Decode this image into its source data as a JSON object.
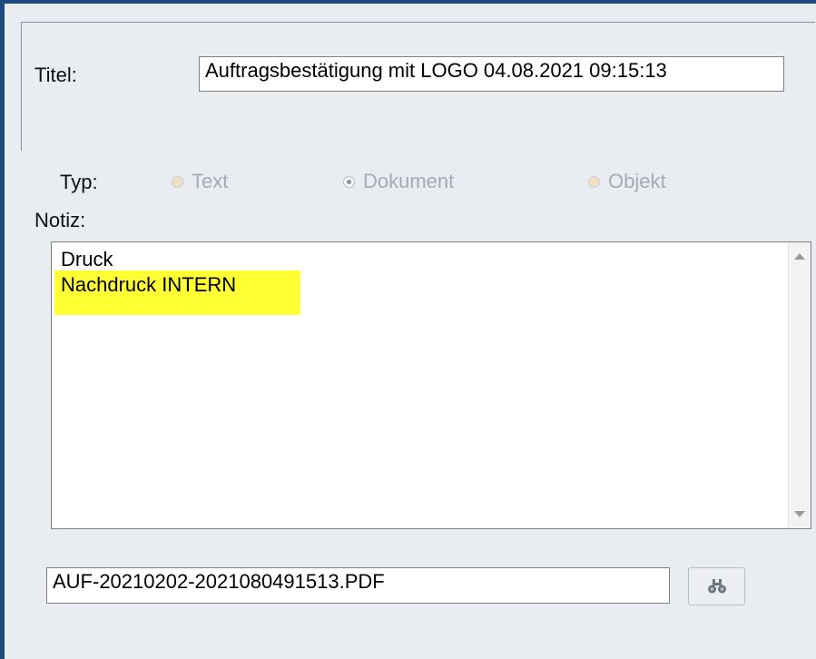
{
  "form": {
    "title_label": "Titel:",
    "title_value": "Auftragsbestätigung mit LOGO 04.08.2021 09:15:13",
    "type_label": "Typ:",
    "type_options": [
      {
        "label": "Text",
        "selected": false,
        "enabled": false
      },
      {
        "label": "Dokument",
        "selected": true,
        "enabled": false
      },
      {
        "label": "Objekt",
        "selected": false,
        "enabled": false
      }
    ],
    "note_label": "Notiz:",
    "note_lines": [
      "Druck",
      "Nachdruck INTERN"
    ],
    "file_value": "AUF-20210202-2021080491513.PDF",
    "browse_icon": "binoculars-icon"
  },
  "colors": {
    "frame_border": "#1f4a80",
    "panel_background": "#e9ecf0",
    "highlight": "#ffff33"
  }
}
